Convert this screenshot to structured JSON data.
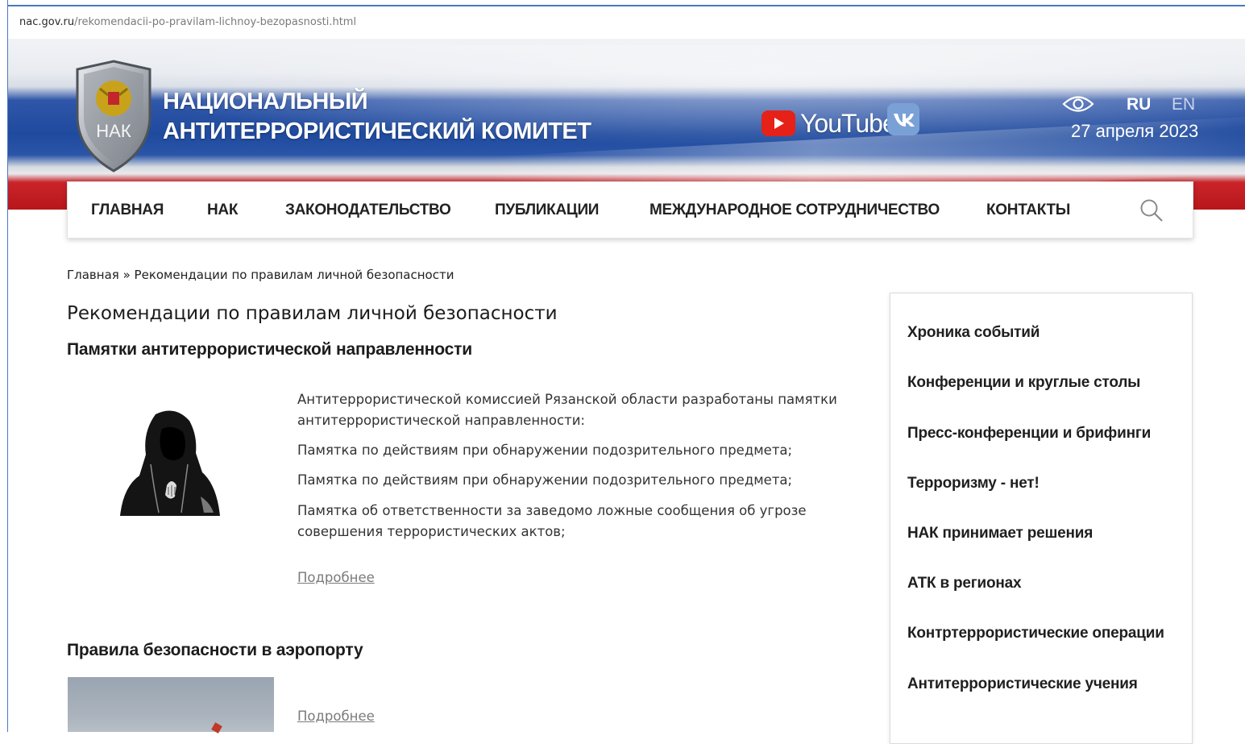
{
  "browser": {
    "url_domain": "nac.gov.ru",
    "url_path": "/rekomendacii-po-pravilam-lichnoy-bezopasnosti.html"
  },
  "header": {
    "emblem_text": "НАК",
    "title_line1": "НАЦИОНАЛЬНЫЙ",
    "title_line2": "АНТИТЕРРОРИСТИЧЕСКИЙ КОМИТЕТ",
    "youtube_label": "YouTube",
    "vk_label": "VK",
    "lang_ru": "RU",
    "lang_en": "EN",
    "date": "27 апреля 2023"
  },
  "nav": {
    "items": [
      {
        "label": "ГЛАВНАЯ"
      },
      {
        "label": "НАК"
      },
      {
        "label": "ЗАКОНОДАТЕЛЬСТВО"
      },
      {
        "label": "ПУБЛИКАЦИИ"
      },
      {
        "label": "МЕЖДУНАРОДНОЕ СОТРУДНИЧЕСТВО"
      },
      {
        "label": "КОНТАКТЫ"
      }
    ]
  },
  "breadcrumb": {
    "home": "Главная",
    "separator": "»",
    "current": "Рекомендации по правилам личной безопасности"
  },
  "main": {
    "page_title": "Рекомендации по правилам личной безопасности",
    "sections": [
      {
        "title": "Памятки антитеррористической направленности",
        "paragraphs": [
          "Антитеррористической комиссией Рязанской области разработаны памятки антитеррористической направленности:",
          "Памятка по действиям при обнаружении подозрительного предмета;",
          "Памятка по действиям при обнаружении подозрительного предмета;",
          "Памятка об ответственности за заведомо ложные сообщения об угрозе совершения террористических актов;"
        ],
        "more_label": "Подробнее"
      },
      {
        "title": "Правила безопасности в аэропорту",
        "more_label": "Подробнее"
      }
    ]
  },
  "sidebar": {
    "items": [
      {
        "label": "Хроника событий"
      },
      {
        "label": "Конференции и круглые столы"
      },
      {
        "label": "Пресс-конференции и брифинги"
      },
      {
        "label": "Терроризму - нет!"
      },
      {
        "label": "НАК принимает решения"
      },
      {
        "label": "АТК в регионах"
      },
      {
        "label": "Контртеррористические операции"
      },
      {
        "label": "Антитеррористические учения"
      }
    ]
  },
  "colors": {
    "flag_blue": "#1f4a9e",
    "flag_red": "#b8161c",
    "youtube_red": "#e62117",
    "vk_blue": "#7aa1d6"
  }
}
